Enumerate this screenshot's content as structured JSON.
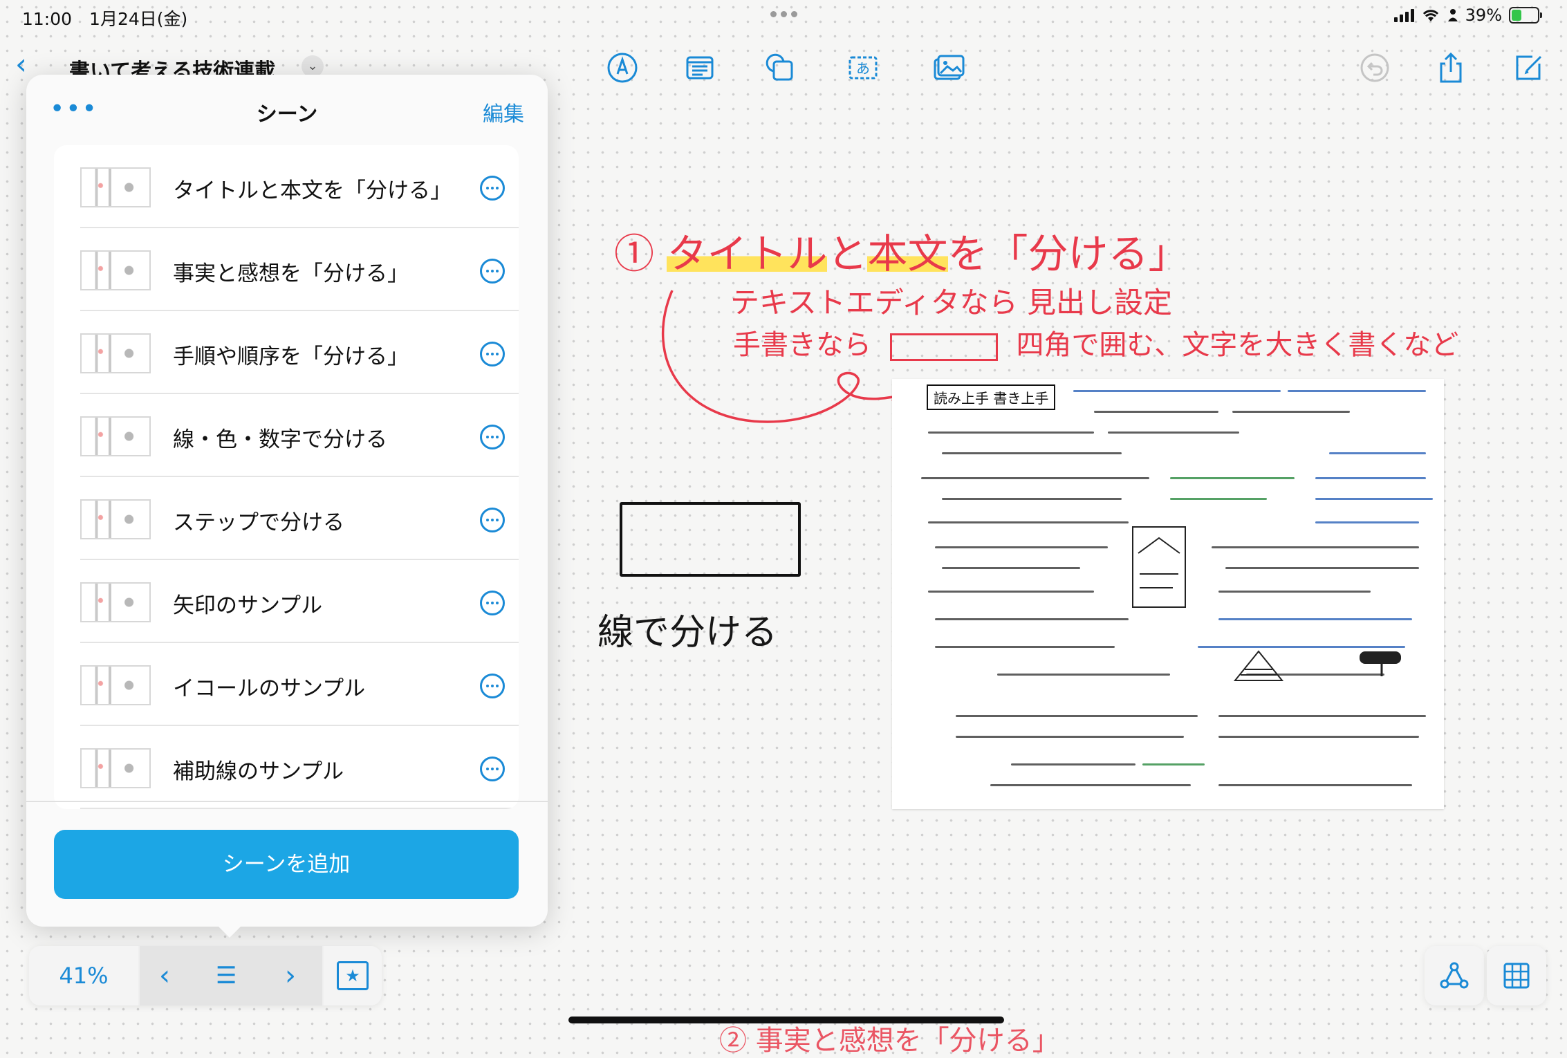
{
  "status_bar": {
    "time_date": "11:00　1月24日(金)",
    "battery": "39%"
  },
  "header": {
    "title": "書いて考える技術連載"
  },
  "toolbar": {
    "tools": [
      "pen-tool-icon",
      "text-box-icon",
      "shapes-icon",
      "sticky-text-icon",
      "media-icon"
    ],
    "right": [
      "undo-icon",
      "share-icon",
      "compose-icon"
    ]
  },
  "scenes_panel": {
    "title": "シーン",
    "edit_label": "編集",
    "items": [
      {
        "label": "タイトルと本文を「分ける」"
      },
      {
        "label": "事実と感想を「分ける」"
      },
      {
        "label": "手順や順序を「分ける」"
      },
      {
        "label": "線・色・数字で分ける"
      },
      {
        "label": "ステップで分ける"
      },
      {
        "label": "矢印のサンプル"
      },
      {
        "label": "イコールのサンプル"
      },
      {
        "label": "補助線のサンプル"
      }
    ],
    "add_button": "シーンを追加"
  },
  "navigator": {
    "zoom": "41%"
  },
  "canvas": {
    "heading_prefix": "①",
    "heading_title": "タイトル",
    "heading_and": "と",
    "heading_body": "本文",
    "heading_rest": "を「分ける」",
    "line1": "テキストエディタなら 見出し設定",
    "line2a": "手書きなら",
    "line2b": "四角で囲む、文字を大きく書くなど",
    "lines_caption": "線で分ける",
    "note_title": "読み上手 書き上手",
    "bottom_text": "② 事実と感想を「分ける」"
  },
  "colors": {
    "accent": "#1a8ad6",
    "add_button": "#1ca6e5",
    "handwriting_red": "#e8394a",
    "highlight": "#ffe35c"
  }
}
